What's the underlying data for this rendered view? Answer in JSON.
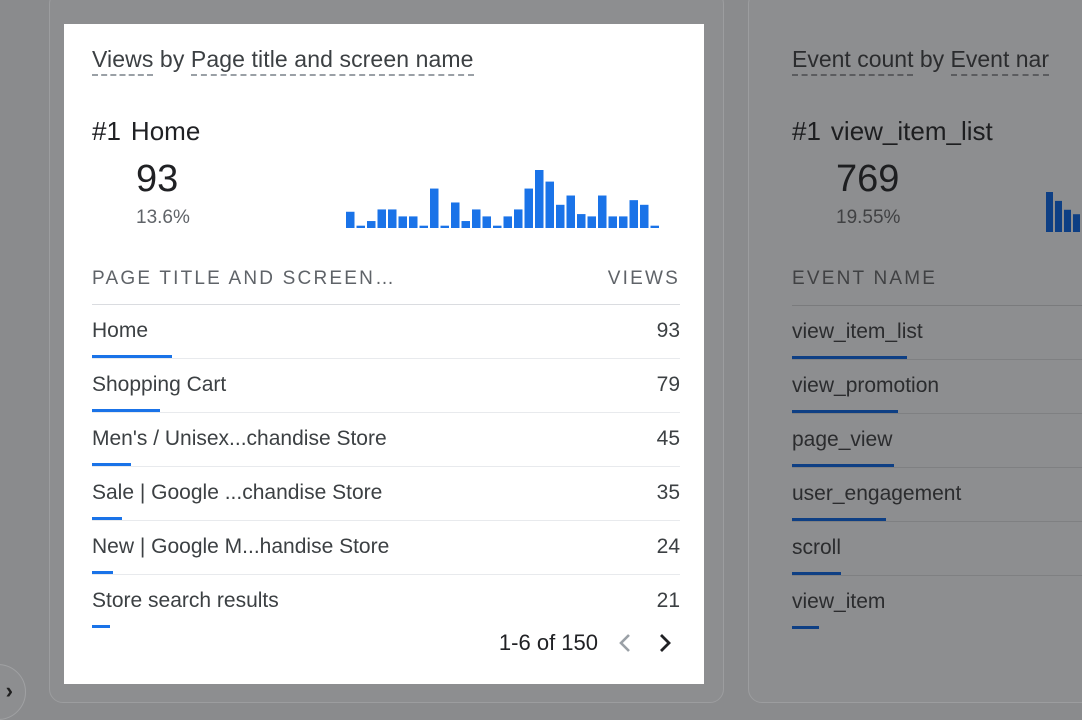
{
  "card_left": {
    "title_dim1": "Views",
    "title_by": " by ",
    "title_dim2": "Page title and screen name",
    "top_rank": "#1",
    "top_name": "Home",
    "top_value": "93",
    "top_pct": "13.6%",
    "column_name": "PAGE TITLE AND SCREEN…",
    "column_value": "VIEWS",
    "rows": [
      {
        "label": "Home",
        "value": "93"
      },
      {
        "label": "Shopping Cart",
        "value": "79"
      },
      {
        "label": "Men's / Unisex...chandise Store",
        "value": "45"
      },
      {
        "label": "Sale | Google ...chandise Store",
        "value": "35"
      },
      {
        "label": "New | Google M...handise Store",
        "value": "24"
      },
      {
        "label": "Store search results",
        "value": "21"
      }
    ],
    "pager_text": "1-6 of 150",
    "accent_color": "#1a73e8",
    "sparkline": [
      7,
      1,
      3,
      8,
      8,
      5,
      5,
      1,
      17,
      1,
      11,
      3,
      8,
      5,
      1,
      5,
      8,
      17,
      25,
      20,
      10,
      14,
      6,
      5,
      14,
      5,
      5,
      12,
      10,
      1
    ]
  },
  "card_right": {
    "title_dim1": "Event count",
    "title_by": " by ",
    "title_dim2": "Event nar",
    "top_rank": "#1",
    "top_name": "view_item_list",
    "top_value": "769",
    "top_pct": "19.55%",
    "column_name": "EVENT NAME",
    "rows": [
      {
        "label": "view_item_list"
      },
      {
        "label": "view_promotion"
      },
      {
        "label": "page_view"
      },
      {
        "label": "user_engagement"
      },
      {
        "label": "scroll"
      },
      {
        "label": "view_item"
      }
    ],
    "sparkline": [
      9,
      7,
      5,
      4
    ]
  },
  "icons": {
    "prev": "chevron-left-icon",
    "next": "chevron-right-icon",
    "side": "chevron-right-icon"
  }
}
